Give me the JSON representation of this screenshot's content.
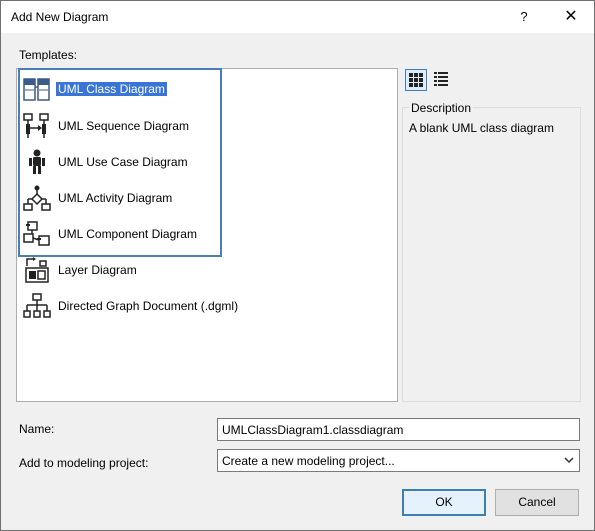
{
  "window": {
    "title": "Add New Diagram",
    "help_label": "?",
    "close_label": "✕"
  },
  "templates": {
    "label": "Templates:",
    "items": [
      {
        "label": "UML Class Diagram",
        "icon": "class-diagram-icon",
        "selected": true
      },
      {
        "label": "UML Sequence Diagram",
        "icon": "sequence-diagram-icon"
      },
      {
        "label": "UML Use Case Diagram",
        "icon": "use-case-diagram-icon"
      },
      {
        "label": "UML Activity Diagram",
        "icon": "activity-diagram-icon"
      },
      {
        "label": "UML Component Diagram",
        "icon": "component-diagram-icon"
      },
      {
        "label": "Layer Diagram",
        "icon": "layer-diagram-icon"
      },
      {
        "label": "Directed Graph Document (.dgml)",
        "icon": "directed-graph-icon"
      }
    ]
  },
  "view_toggle": {
    "active": "grid-view",
    "icons": [
      "grid-view-icon",
      "list-view-icon"
    ]
  },
  "description": {
    "title": "Description",
    "text": "A blank UML class diagram"
  },
  "name_field": {
    "label": "Name:",
    "value": "UMLClassDiagram1.classdiagram"
  },
  "project_field": {
    "label": "Add to modeling project:",
    "value": "Create a new modeling project..."
  },
  "buttons": {
    "ok": "OK",
    "cancel": "Cancel"
  }
}
